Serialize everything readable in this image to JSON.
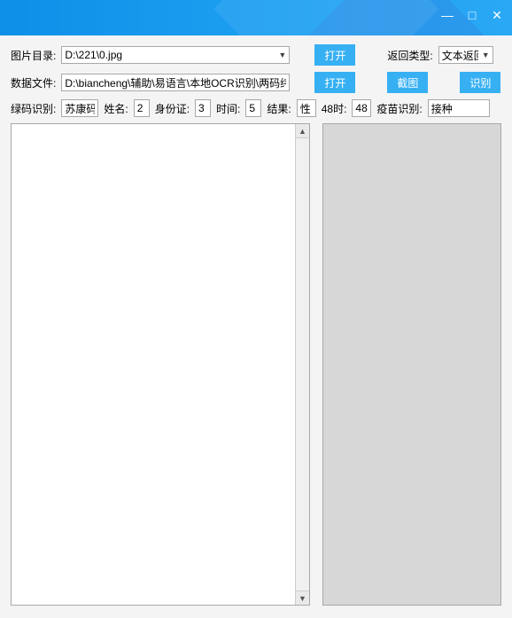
{
  "window": {
    "minimize_glyph": "—",
    "maximize_glyph": "□",
    "close_glyph": "✕"
  },
  "row1": {
    "img_dir_label": "图片目录:",
    "img_dir_value": "D:\\221\\0.jpg",
    "open_btn": "打开",
    "return_type_label": "返回类型:",
    "return_type_value": "文本返回"
  },
  "row2": {
    "data_file_label": "数据文件:",
    "data_file_value": "D:\\biancheng\\辅助\\易语言\\本地OCR识别\\两码纬",
    "open_btn": "打开",
    "capture_btn": "截图",
    "recognize_btn": "识别"
  },
  "row3": {
    "green_code_label": "绿码识别:",
    "green_code_value": "苏康码",
    "name_label": "姓名:",
    "name_value": "2",
    "id_label": "身份证:",
    "id_value": "3",
    "time_label": "时间:",
    "time_value": "5",
    "result_label": "结果:",
    "result_value": "性",
    "h48_label": "48时:",
    "h48_value": "48",
    "vaccine_label": "疫苗识别:",
    "vaccine_value": "接种"
  },
  "glyphs": {
    "dropdown": "▼",
    "up": "▲",
    "down": "▼"
  }
}
